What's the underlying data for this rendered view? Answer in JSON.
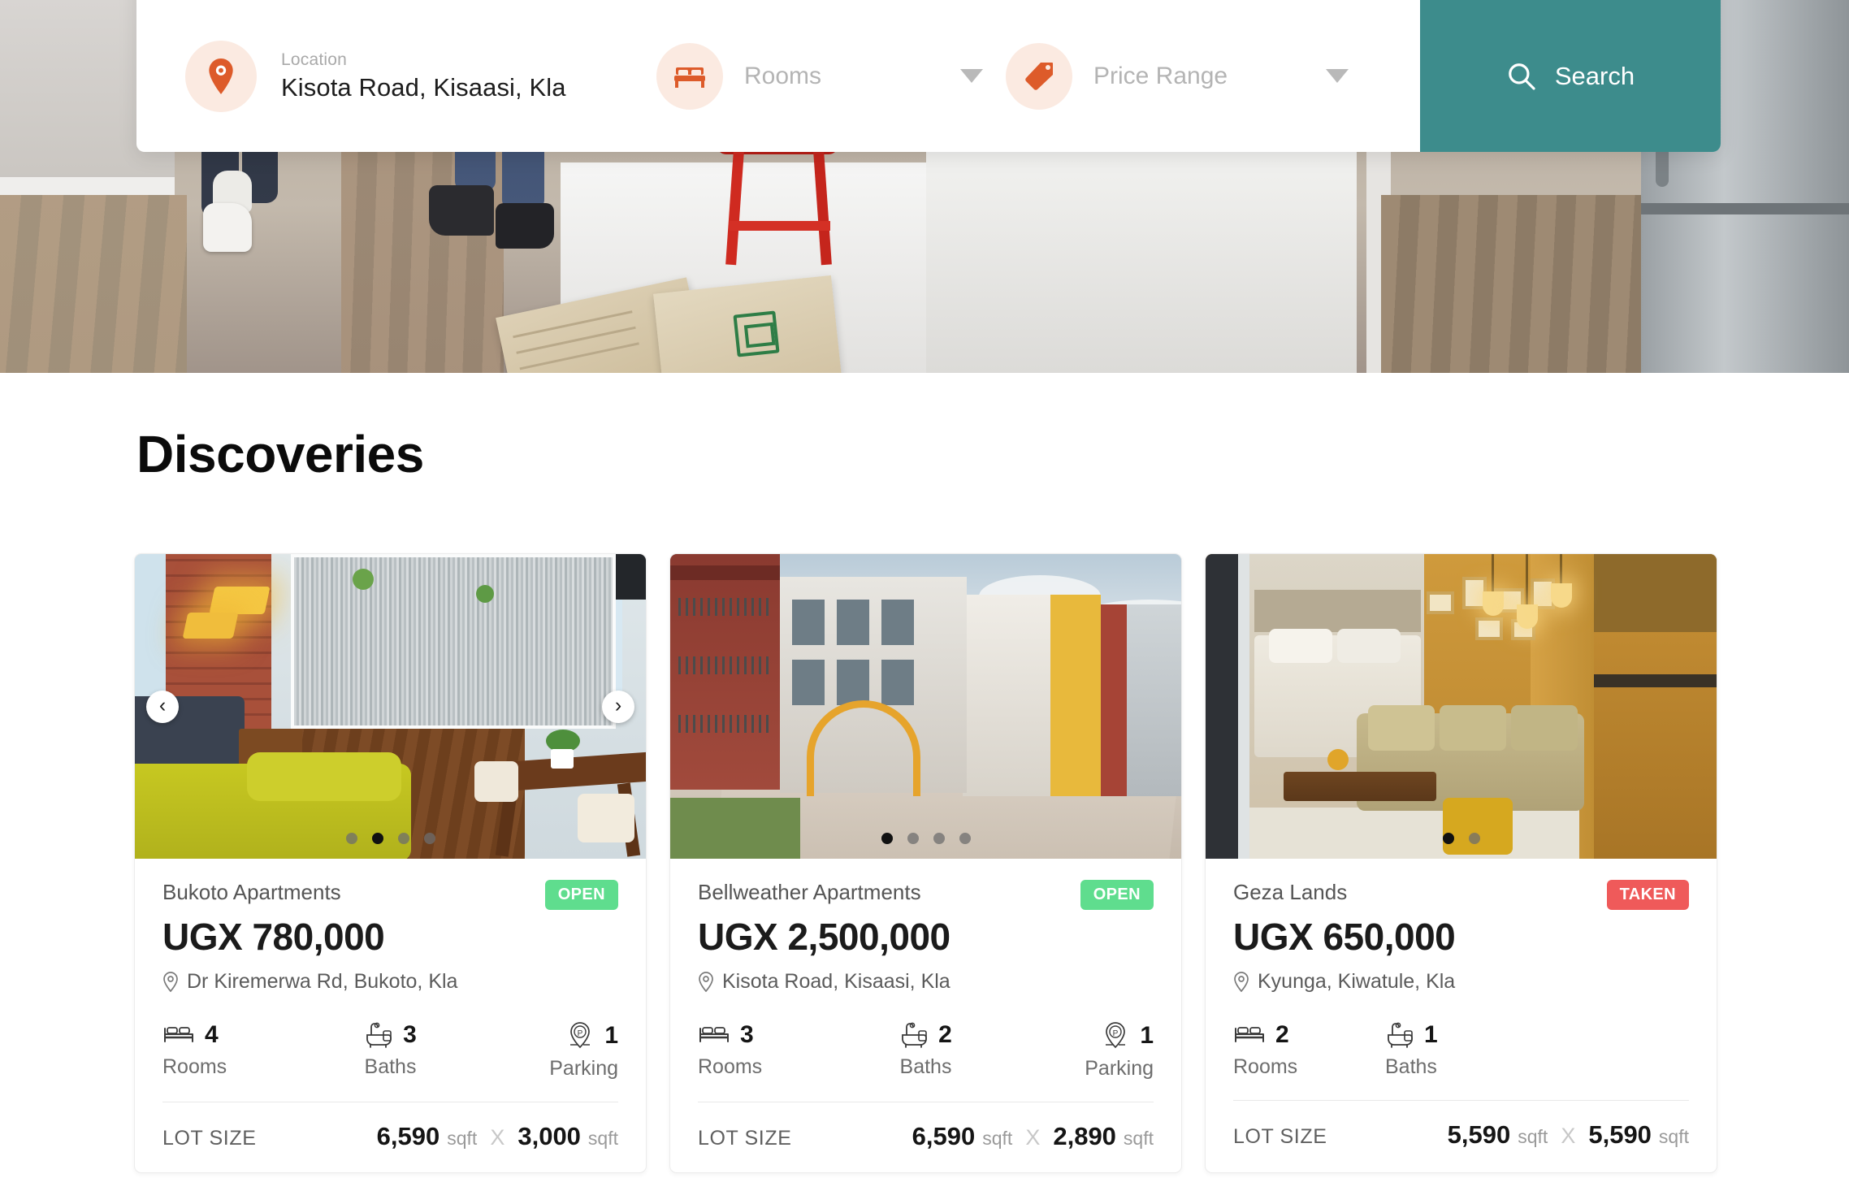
{
  "search": {
    "location": {
      "icon": "map-pin-icon",
      "label": "Location",
      "value": "Kisota Road, Kisaasi, Kla"
    },
    "rooms": {
      "icon": "bed-icon",
      "placeholder": "Rooms"
    },
    "price": {
      "icon": "price-tag-icon",
      "placeholder": "Price Range"
    },
    "button": {
      "icon": "search-icon",
      "label": "Search",
      "color": "#3d8c8c"
    }
  },
  "section": {
    "title": "Discoveries"
  },
  "carousel": {
    "prev_icon": "chevron-left-icon",
    "next_icon": "chevron-right-icon"
  },
  "labels": {
    "rooms": "Rooms",
    "baths": "Baths",
    "parking": "Parking",
    "lot_size": "LOT SIZE",
    "sqft": "sqft",
    "times": "X",
    "pin_icon": "map-pin-icon",
    "bed_icon": "bed-icon",
    "bath_icon": "bathtub-icon",
    "parking_icon": "parking-pin-icon"
  },
  "badge_colors": {
    "open": "#5fdd8e",
    "taken": "#ef5a5a"
  },
  "cards": [
    {
      "name": "Bukoto Apartments",
      "status": "OPEN",
      "status_type": "open",
      "price": "UGX 780,000",
      "address": "Dr Kiremerwa Rd, Bukoto, Kla",
      "rooms": "4",
      "baths": "3",
      "parking": "1",
      "lot_w": "6,590",
      "lot_h": "3,000",
      "dots": 4,
      "active_dot": 1
    },
    {
      "name": "Bellweather Apartments",
      "status": "OPEN",
      "status_type": "open",
      "price": "UGX 2,500,000",
      "address": "Kisota Road, Kisaasi, Kla",
      "rooms": "3",
      "baths": "2",
      "parking": "1",
      "lot_w": "6,590",
      "lot_h": "2,890",
      "dots": 4,
      "active_dot": 0
    },
    {
      "name": "Geza Lands",
      "status": "TAKEN",
      "status_type": "taken",
      "price": "UGX 650,000",
      "address": "Kyunga, Kiwatule, Kla",
      "rooms": "2",
      "baths": "1",
      "parking": null,
      "lot_w": "5,590",
      "lot_h": "5,590",
      "dots": 2,
      "active_dot": 0
    }
  ]
}
